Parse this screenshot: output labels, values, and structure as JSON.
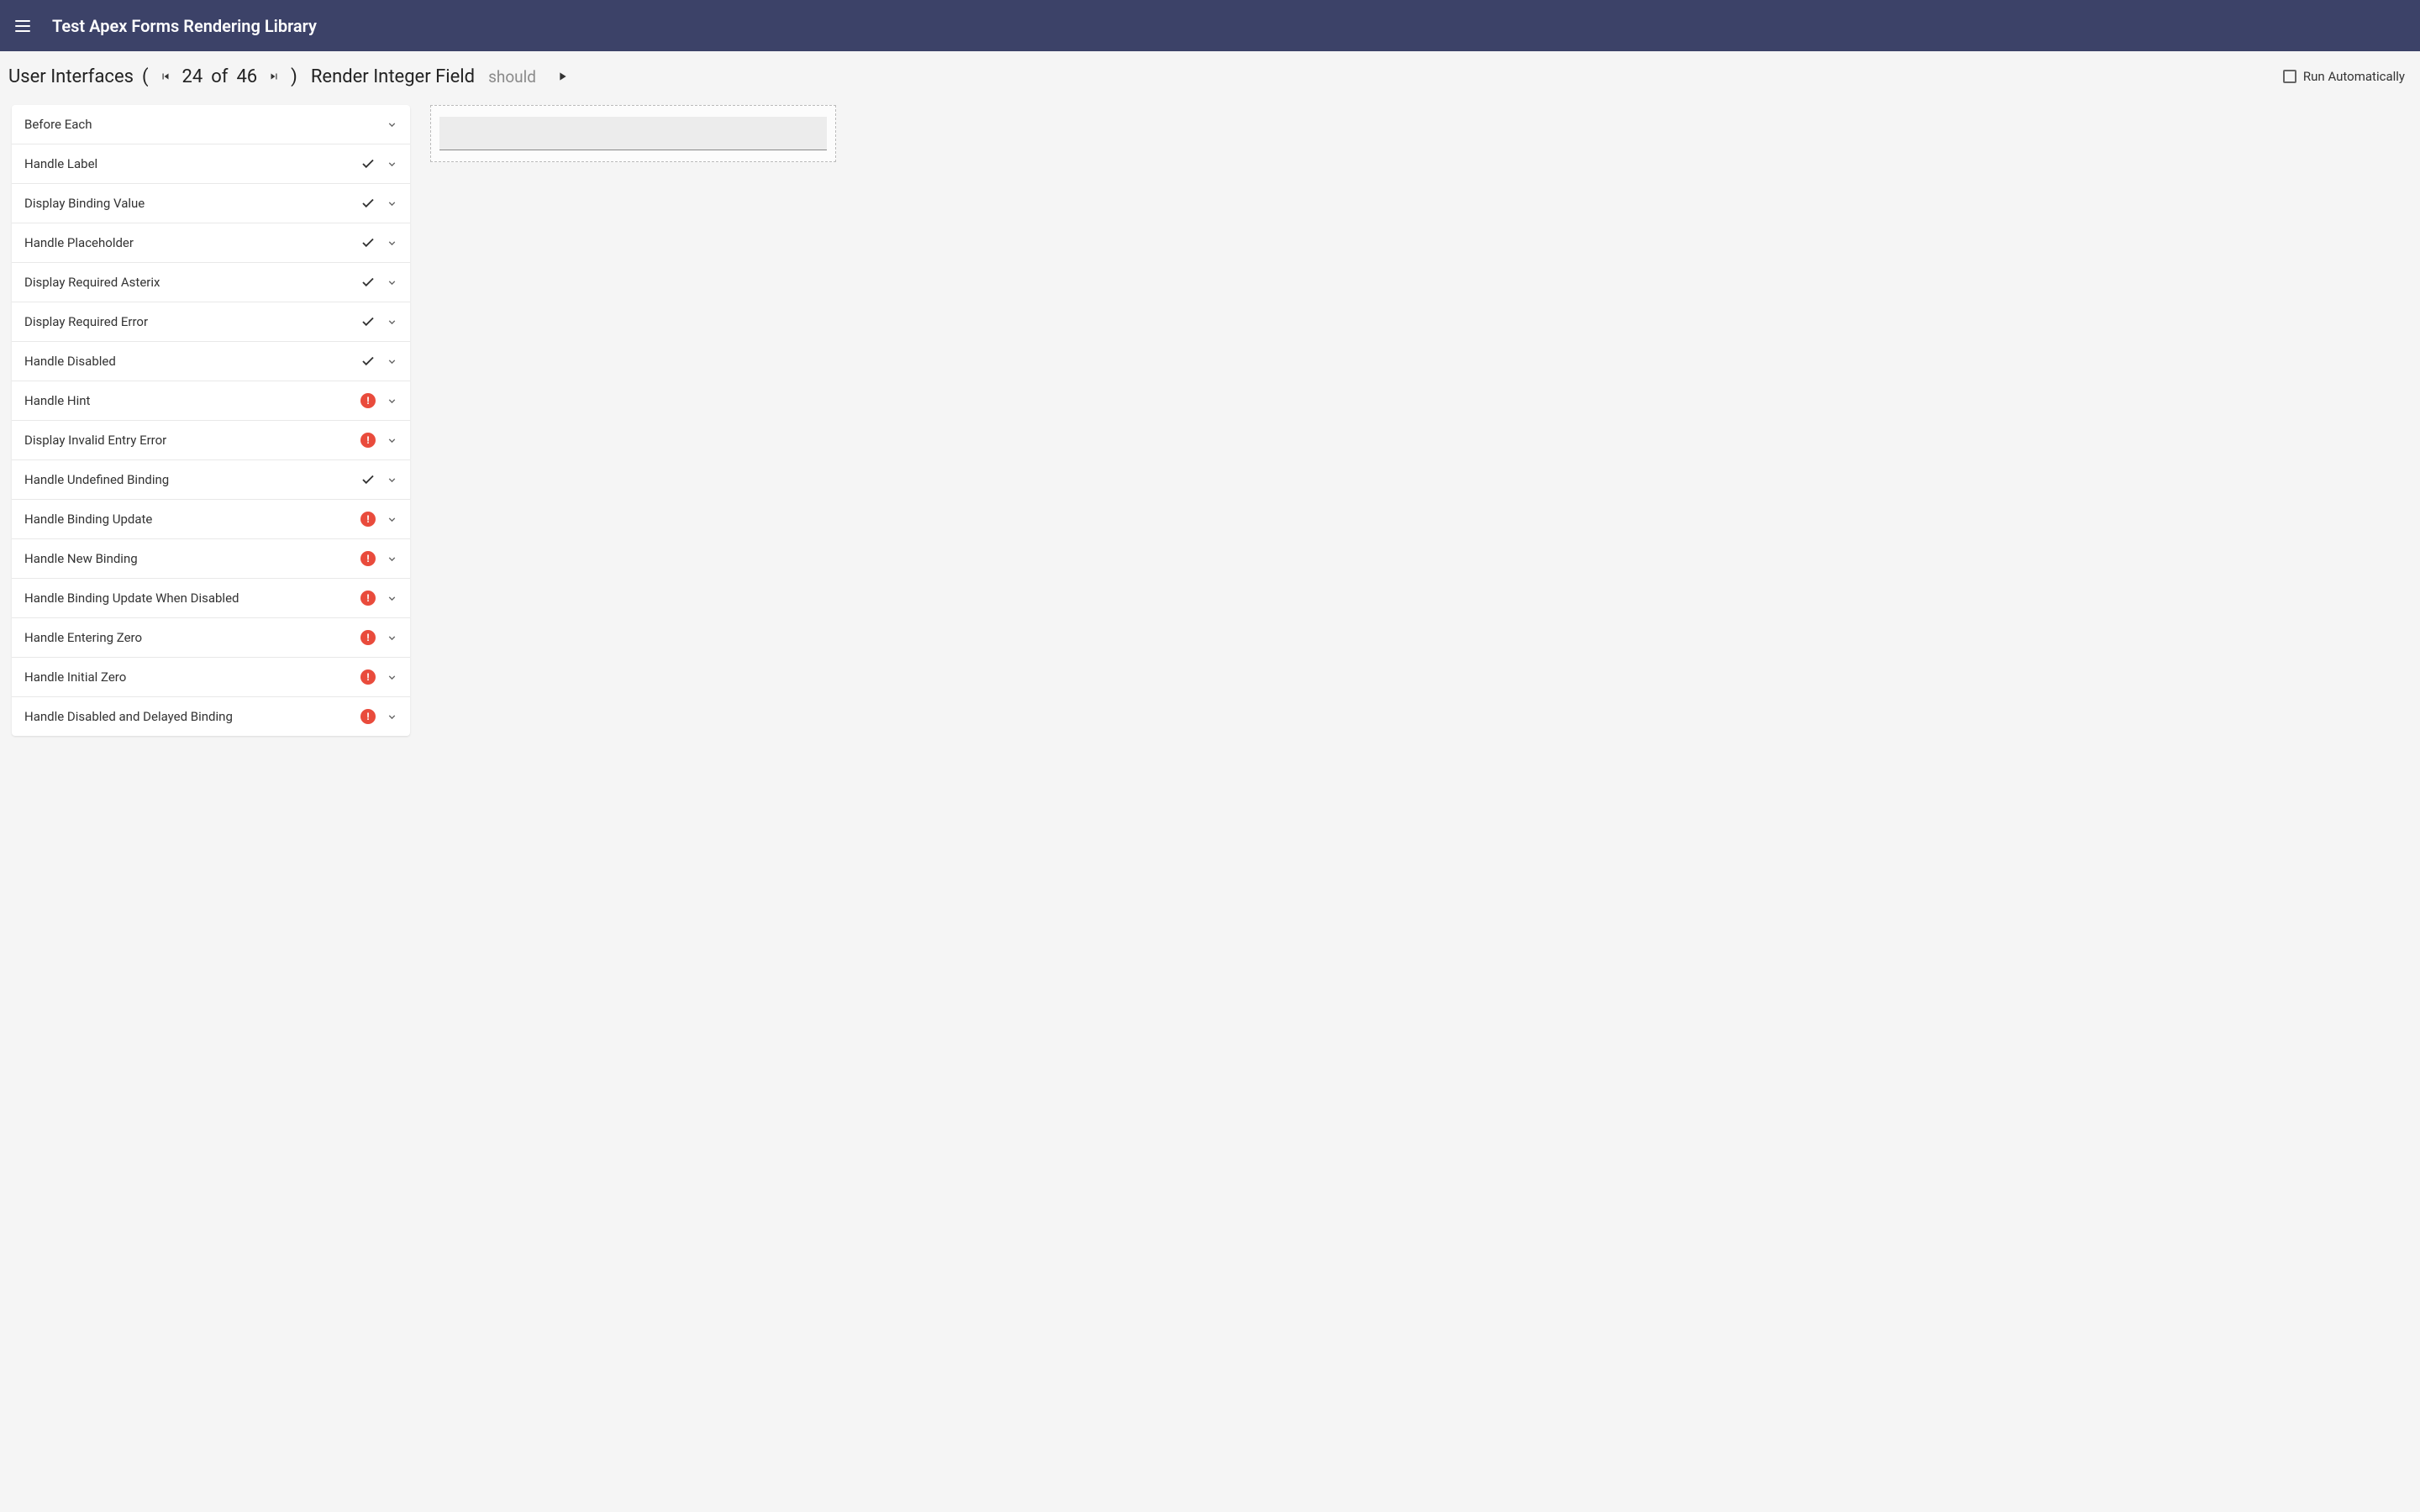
{
  "header": {
    "title": "Test Apex Forms Rendering Library"
  },
  "subheader": {
    "section": "User Interfaces",
    "pager_current": "24",
    "pager_of": "of",
    "pager_total": "46",
    "test_name": "Render Integer Field",
    "should": "should",
    "run_auto": "Run Automatically"
  },
  "tests": [
    {
      "label": "Before Each",
      "status": "none"
    },
    {
      "label": "Handle Label",
      "status": "pass"
    },
    {
      "label": "Display Binding Value",
      "status": "pass"
    },
    {
      "label": "Handle Placeholder",
      "status": "pass"
    },
    {
      "label": "Display Required Asterix",
      "status": "pass"
    },
    {
      "label": "Display Required Error",
      "status": "pass"
    },
    {
      "label": "Handle Disabled",
      "status": "pass"
    },
    {
      "label": "Handle Hint",
      "status": "fail"
    },
    {
      "label": "Display Invalid Entry Error",
      "status": "fail"
    },
    {
      "label": "Handle Undefined Binding",
      "status": "pass"
    },
    {
      "label": "Handle Binding Update",
      "status": "fail"
    },
    {
      "label": "Handle New Binding",
      "status": "fail"
    },
    {
      "label": "Handle Binding Update When Disabled",
      "status": "fail"
    },
    {
      "label": "Handle Entering Zero",
      "status": "fail"
    },
    {
      "label": "Handle Initial Zero",
      "status": "fail"
    },
    {
      "label": "Handle Disabled and Delayed Binding",
      "status": "fail"
    }
  ]
}
